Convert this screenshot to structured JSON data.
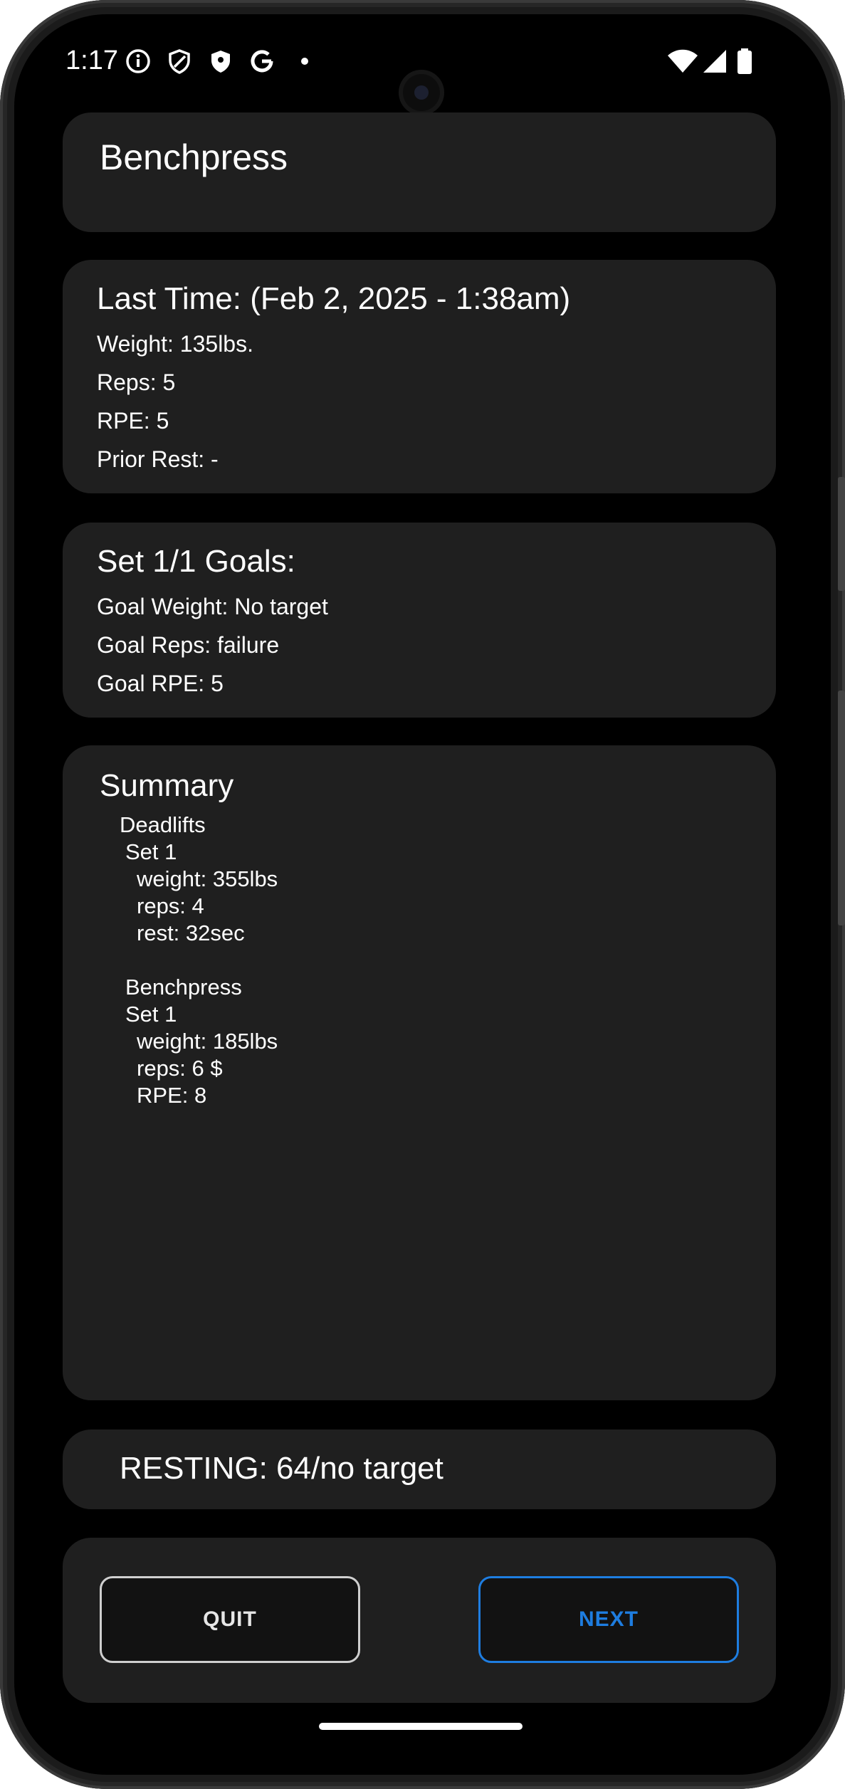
{
  "status_bar": {
    "time": "1:17",
    "left_icons": [
      "info-icon",
      "shield-outline-icon",
      "shield-filled-icon",
      "google-icon",
      "dot-icon"
    ],
    "right_icons": [
      "wifi-icon",
      "cellular-signal-icon",
      "battery-icon"
    ]
  },
  "exercise": {
    "name": "Benchpress"
  },
  "last_time": {
    "heading": "Last Time: (Feb 2, 2025 - 1:38am)",
    "weight": "Weight: 135lbs.",
    "reps": "Reps: 5",
    "rpe": "RPE: 5",
    "prior_rest": "Prior Rest: -"
  },
  "goals": {
    "heading": "Set 1/1 Goals:",
    "weight": "Goal Weight: No target",
    "reps": "Goal Reps: failure",
    "rpe": "Goal RPE: 5"
  },
  "summary": {
    "heading": "Summary",
    "lines": [
      "Deadlifts",
      "Set 1",
      "weight: 355lbs",
      "reps: 4",
      "rest: 32sec",
      "",
      "Benchpress",
      "Set 1",
      "weight: 185lbs",
      "reps: 6 $",
      "RPE: 8"
    ]
  },
  "resting": {
    "text": "RESTING: 64/no target"
  },
  "actions": {
    "quit_label": "QUIT",
    "next_label": "NEXT"
  },
  "colors": {
    "accent": "#1e7de0",
    "card": "#1f1f1f",
    "background": "#000000"
  }
}
